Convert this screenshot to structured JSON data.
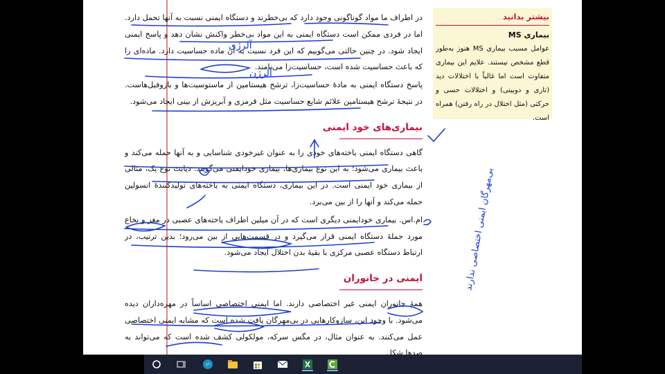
{
  "main_text": {
    "para1": "در اطراف ما مواد گوناگونی وجود دارد که بی‌خطرند و دستگاه ایمنی نسبت به آنها تحمل دارد. اما در فردی ممکن است دستگاه ایمنی به این مواد بی‌خطر واکنش نشان دهد و پاسخ ایمنی ایجاد شود. در چنین حالتی می‌گوییم که این فرد نسبت به آن ماده حساسیت دارد. ماده‌ای را که باعث حساسیت شده است، حساسیت‌زا می‌نامند.",
    "para2": "پاسخ دستگاه ایمنی به مادهٔ حساسیت‌زا، ترشح هیستامین از ماستوسیت‌ها و بازوفیل‌هاست. در نتیجهٔ ترشح هیستامین علائم شایع حساسیت مثل قرمزی و آبریزش از بینی ایجاد می‌شود.",
    "heading1": "بیماری‌های خود ایمنی",
    "para3": "گاهی دستگاه ایمنی یاخته‌های خودی را به عنوان غیرخودی شناسایی و به آنها حمله می‌کند و باعث بیماری می‌شود؛ به این نوع بیماری‌ها، بیماری خودایمنی می‌گویند. دیابت نوع یک، مثالی از بیماری خود ایمنی است. در این بیماری، دستگاه ایمنی به یاخته‌های تولیدکنندهٔ انسولین حمله می‌کند و آنها را از بین می‌برد.",
    "para4": "ام.اس. بیماری خودایمنی دیگری است که در آن میلین اطراف یاخته‌های عصبی در مغز و نخاع مورد حملهٔ دستگاه ایمنی قرار می‌گیرد و در قسمت‌هایی از بین می‌رود؛ بدین ترتیب، در ارتباط دستگاه عصبی مرکزی با بقیهٔ بدن اختلال ایجاد می‌شود.",
    "heading2": "ایمنی در جانوران",
    "para5": "همهٔ جانوران ایمنی غیر اختصاصی دارند. اما ایمنی اختصاصی اساساً در مهره‌داران دیده می‌شود. با وجود این، سازوکارهایی در بی‌مهرگان یافت شده است که مشابه ایمنی اختصاصی عمل می‌کنند. به عنوان مثال، در مگس سرکه، مولکولی کشف شده است که می‌تواند به صدها شکل"
  },
  "sidebar": {
    "title": "بیشتر بدانید",
    "subtitle": "بیماری MS",
    "body": "عوامل مسبب بیماری MS هنوز به‌طور قطع مشخص نیستند. علایم این بیماری متفاوت است اما غالباً با اختلالات دید (تاری و دوبینی) و اختلالات حسی و حرکتی (مثل اختلال در راه رفتن) همراه است."
  },
  "handwriting": {
    "note1": "آلرژی",
    "note2": "آلرژن",
    "margin_note": "بی‌مهرگان ایمنی اختصاصی ندارند"
  },
  "taskbar": {
    "icons": [
      "start-circle-icon",
      "task-view-icon",
      "edge-browser-icon",
      "file-explorer-icon",
      "store-icon",
      "mail-icon",
      "excel-icon",
      "camtasia-icon"
    ]
  },
  "colors": {
    "heading": "#c0143c",
    "ink": "#1a3fd0",
    "sidebar_bg": "#fbf6d3",
    "taskbar": "#1c2233"
  }
}
